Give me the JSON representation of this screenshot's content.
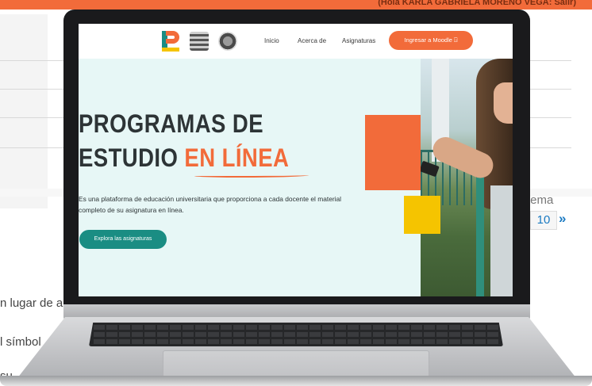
{
  "background_page": {
    "greeting": "(Hola KARLA GABRIELA MORENO VEGA: Salir)",
    "side_text_1": "n lugar de a",
    "side_text_2": "l símbol",
    "side_text_3": "su",
    "tema_label": "tema",
    "pager_value": "10",
    "pager_next": "»"
  },
  "site": {
    "nav": {
      "links": [
        "Inicio",
        "Acerca de",
        "Asignaturas"
      ],
      "cta": "Ingresar a Moodle ⍈"
    },
    "hero": {
      "title_line1": "PROGRAMAS DE",
      "title_line2_prefix": "ESTUDIO ",
      "title_line2_accent": "EN LÍNEA",
      "description": "Es una plataforma de educación universitaria que proporciona a cada docente el material completo de su asignatura en línea.",
      "cta_label": "Explora las asignaturas"
    }
  },
  "colors": {
    "brand_orange": "#f26b3a",
    "brand_teal": "#1a8d83",
    "brand_yellow": "#f5c400",
    "hero_bg": "#e7f7f6"
  },
  "icons": [
    "logo-p",
    "unam-crest",
    "faculty-crest"
  ]
}
